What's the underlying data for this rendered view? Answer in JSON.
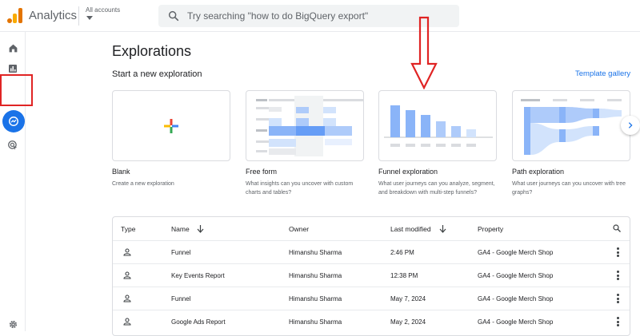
{
  "header": {
    "app_title": "Analytics",
    "account_label": "All accounts",
    "search_placeholder": "Try searching \"how to do BigQuery export\""
  },
  "rail": {
    "items": [
      {
        "name": "home-icon"
      },
      {
        "name": "reports-icon"
      },
      {
        "name": "explore-icon",
        "active": true
      },
      {
        "name": "advertising-icon"
      },
      {
        "name": "settings-icon"
      }
    ],
    "accent_color": "#1a73e8",
    "highlight_color": "#e02424"
  },
  "main": {
    "title": "Explorations",
    "start_label": "Start a new exploration",
    "template_gallery": "Template gallery",
    "templates": [
      {
        "title": "Blank",
        "desc": "Create a new exploration"
      },
      {
        "title": "Free form",
        "desc": "What insights can you uncover with custom charts and tables?"
      },
      {
        "title": "Funnel exploration",
        "desc": "What user journeys can you analyze, segment, and breakdown with multi-step funnels?"
      },
      {
        "title": "Path exploration",
        "desc": "What user journeys can you uncover with tree graphs?"
      }
    ]
  },
  "table": {
    "headers": {
      "type": "Type",
      "name": "Name",
      "owner": "Owner",
      "modified": "Last modified",
      "property": "Property"
    },
    "rows": [
      {
        "name": "Funnel",
        "owner": "Himanshu Sharma",
        "modified": "2:46 PM",
        "property": "GA4 - Google Merch Shop"
      },
      {
        "name": "Key Events Report",
        "owner": "Himanshu Sharma",
        "modified": "12:38 PM",
        "property": "GA4 - Google Merch Shop"
      },
      {
        "name": "Funnel",
        "owner": "Himanshu Sharma",
        "modified": "May 7, 2024",
        "property": "GA4 - Google Merch Shop"
      },
      {
        "name": "Google Ads Report",
        "owner": "Himanshu Sharma",
        "modified": "May 2, 2024",
        "property": "GA4 - Google Merch Shop"
      }
    ]
  }
}
